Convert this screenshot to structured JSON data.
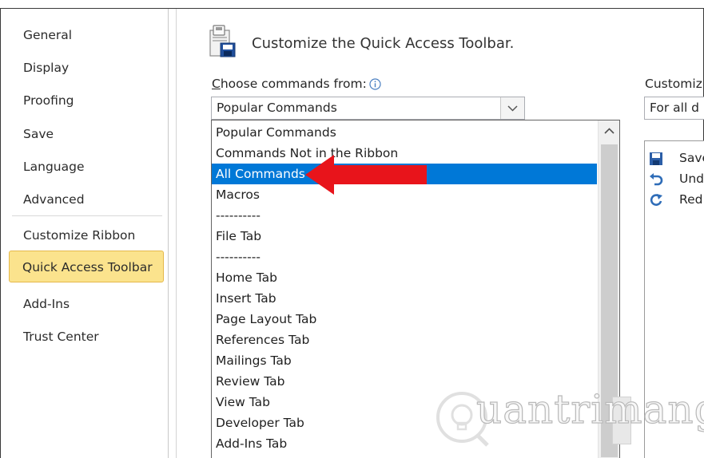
{
  "nav": {
    "items": [
      "General",
      "Display",
      "Proofing",
      "Save",
      "Language",
      "Advanced"
    ],
    "items_after": [
      "Customize Ribbon",
      "Quick Access Toolbar",
      "Add-Ins",
      "Trust Center"
    ],
    "selected": "Quick Access Toolbar"
  },
  "header": {
    "title": "Customize the Quick Access Toolbar.",
    "icon": "quick-access-toolbar-icon"
  },
  "choose": {
    "label_accel": "C",
    "label_rest": "hoose commands from:",
    "info_icon": "info-icon",
    "value": "Popular Commands"
  },
  "list": {
    "items": [
      "Popular Commands",
      "Commands Not in the Ribbon",
      "All Commands",
      "Macros",
      "----------",
      "File Tab",
      "----------",
      "Home Tab",
      "Insert Tab",
      "Page Layout Tab",
      "References Tab",
      "Mailings Tab",
      "Review Tab",
      "View Tab",
      "Developer Tab",
      "Add-Ins Tab"
    ],
    "selected": "All Commands"
  },
  "right": {
    "label": "Customiz",
    "value": "For all d",
    "items": [
      {
        "label": "Save",
        "icon": "save-icon"
      },
      {
        "label": "Und",
        "icon": "undo-icon"
      },
      {
        "label": "Red",
        "icon": "redo-icon"
      }
    ]
  },
  "watermark": {
    "text": "uantrimang"
  },
  "colors": {
    "selection": "#0078d7",
    "nav_selected_bg": "#fbe38d",
    "arrow": "#e8141b",
    "qat_icon": "#2b6cb0"
  }
}
